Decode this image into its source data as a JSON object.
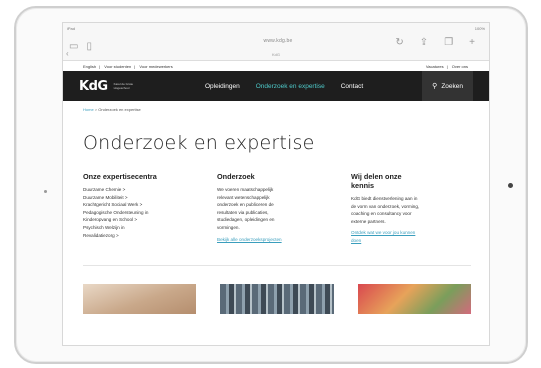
{
  "browser": {
    "status_left": "iPad",
    "status_right": "100%",
    "url": "www.kdg.be",
    "tab_title": "KdG"
  },
  "utility_bar": {
    "left_links": [
      "English",
      "Voor studenten",
      "Voor medewerkers"
    ],
    "right_links": [
      "Vacatures",
      "Over ons"
    ]
  },
  "nav": {
    "logo_text": "KdG",
    "logo_subtitle": "Karel de Grote Hogeschool",
    "items": [
      "Opleidingen",
      "Onderzoek en expertise",
      "Contact"
    ],
    "active_index": 1,
    "search_label": "Zoeken"
  },
  "breadcrumb": {
    "home": "Home",
    "separator": ">",
    "current": "Onderzoek en expertise"
  },
  "page_title": "Onderzoek en expertise",
  "columns": {
    "expertise": {
      "heading": "Onze expertisecentra",
      "items": [
        "Duurzame Chemie >",
        "Duurzame Mobiliteit >",
        "Krachtgericht Sociaal Werk >",
        "Pedagogische Ondersteuning in",
        "Kinderopvang en School >",
        "Psychisch Welzijn in",
        "Revalidatiezorg >"
      ]
    },
    "onderzoek": {
      "heading": "Onderzoek",
      "lines": [
        "We voeren maatschappelijk",
        "relevant wetenschappelijk",
        "onderzoek en publiceren de",
        "resultaten via publicaties,",
        "studiedagen, opleidingen en",
        "vormingen."
      ],
      "link": "Bekijk alle onderzoeksprojecten"
    },
    "kennis": {
      "heading_line1": "Wij delen onze",
      "heading_line2": "kennis",
      "lines": [
        "KdG biedt dienstverlening aan in",
        "de vorm van onderzoek, vorming,",
        "coaching en consultancy voor",
        "externe partners."
      ],
      "link_line1": "Ontdek wat we voor jou kunnen",
      "link_line2": "doen"
    }
  },
  "colors": {
    "nav_bg": "#1e1e1e",
    "accent": "#4ec9c9",
    "link": "#3a9ebd"
  }
}
